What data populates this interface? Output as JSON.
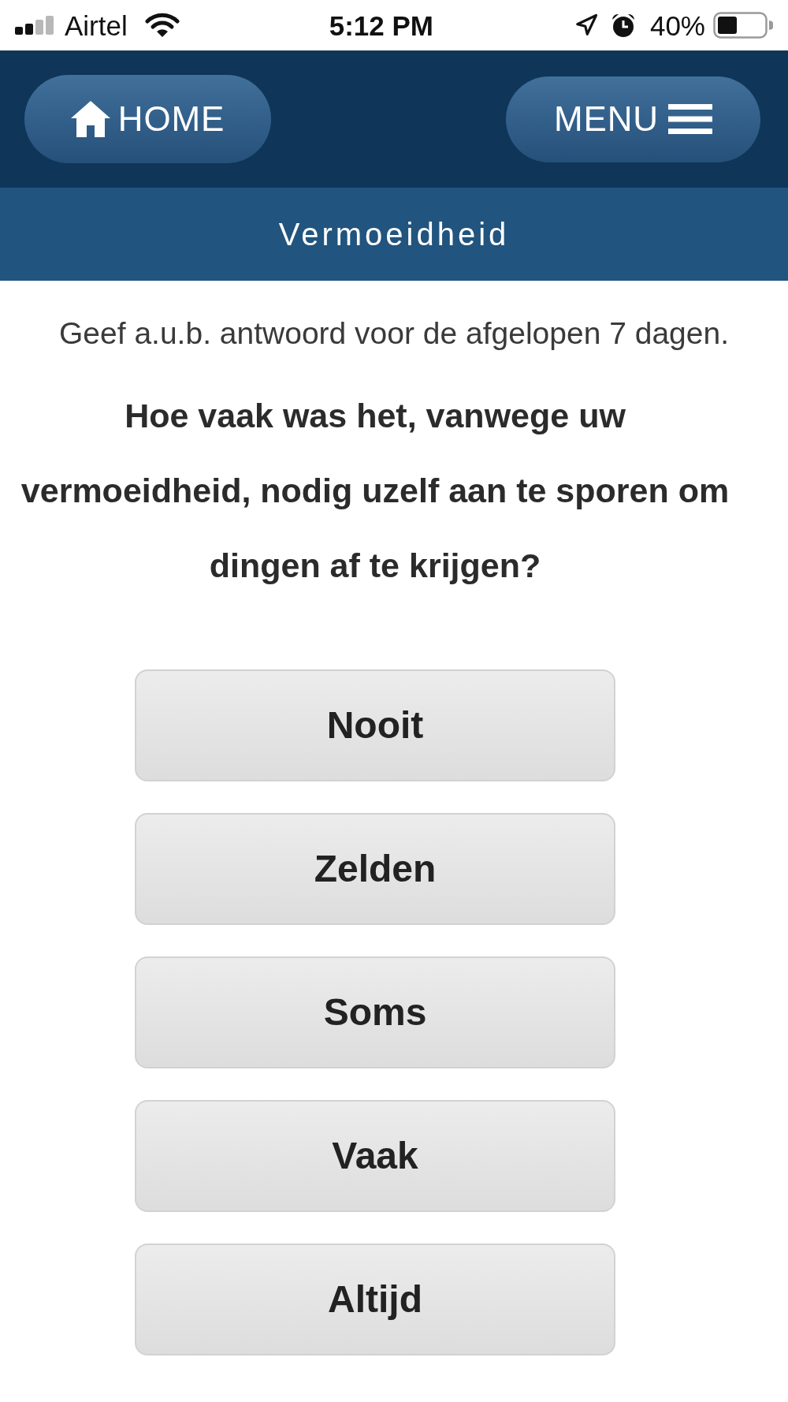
{
  "status_bar": {
    "carrier": "Airtel",
    "time": "5:12 PM",
    "battery": "40%"
  },
  "header": {
    "home_button": "HOME",
    "menu_button": "MENU"
  },
  "title": "Vermoeidheid",
  "instruction": "Geef a.u.b. antwoord voor de afgelopen 7 dagen.",
  "question": "Hoe vaak was het, vanwege uw vermoeidheid, nodig uzelf aan te sporen om dingen af te krijgen?",
  "answers": [
    {
      "label": "Nooit",
      "selected": false
    },
    {
      "label": "Zelden",
      "selected": false
    },
    {
      "label": "Soms",
      "selected": false
    },
    {
      "label": "Vaak",
      "selected": false
    },
    {
      "label": "Altijd",
      "selected": false
    }
  ]
}
